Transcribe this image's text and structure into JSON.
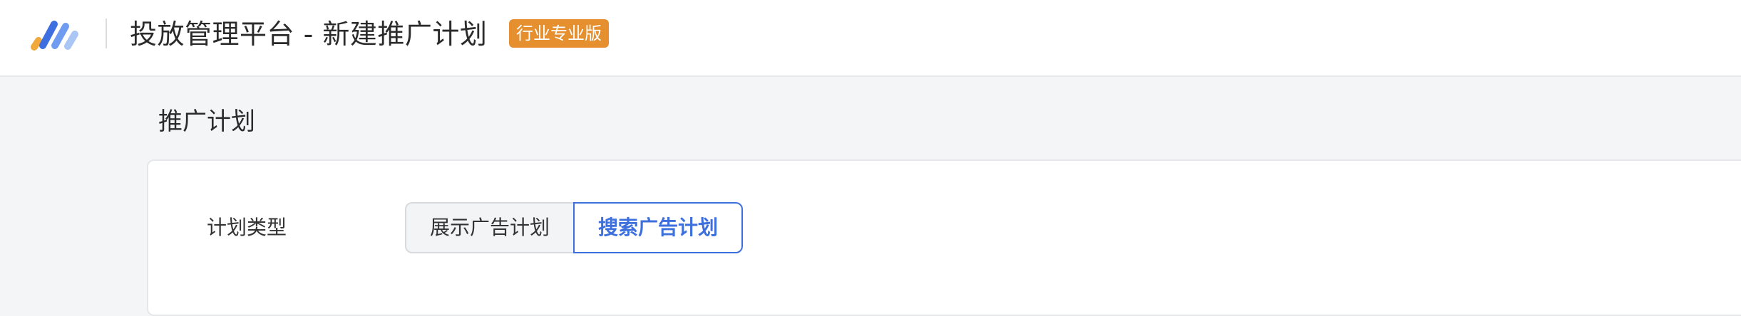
{
  "header": {
    "title": "投放管理平台 - 新建推广计划",
    "badge": "行业专业版",
    "badge_color": "#e58f2f"
  },
  "section": {
    "title": "推广计划"
  },
  "form": {
    "plan_type": {
      "label": "计划类型",
      "options": [
        {
          "label": "展示广告计划",
          "selected": false
        },
        {
          "label": "搜索广告计划",
          "selected": true
        }
      ],
      "active_color": "#3e70dd"
    }
  },
  "logo": {
    "icon": "brand-stripes-icon",
    "colors": [
      "#f0a93a",
      "#3d6fe0",
      "#6f9cf0",
      "#a9c6f5"
    ]
  }
}
